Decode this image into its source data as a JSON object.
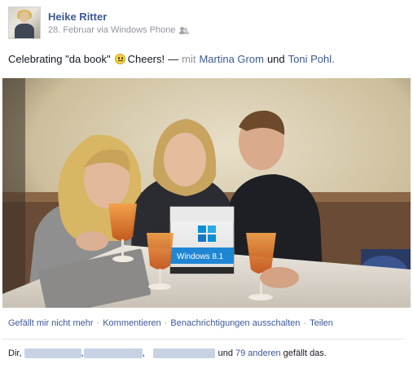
{
  "post": {
    "author": "Heike Ritter",
    "date": "28. Februar",
    "via": "via",
    "source": "Windows Phone",
    "status_text": "Celebrating \"da book\"",
    "status_after": "Cheers!",
    "dash": "—",
    "with_label": "mit",
    "tag_1": "Martina Grom",
    "and_label": "und",
    "tag_2": "Toni Pohl.",
    "book_brand": "Windows 8.1"
  },
  "actions": {
    "unlike": "Gefällt mir nicht mehr",
    "comment": "Kommentieren",
    "notifications": "Benachrichtigungen ausschalten",
    "share": "Teilen",
    "separator": "·"
  },
  "likes": {
    "prefix": "Dir,",
    "comma": ",",
    "and_word": "und",
    "others": "79 anderen",
    "suffix": "gefällt das."
  },
  "icons": {
    "audience": "friends-icon",
    "emoji": "smiley-emoji-icon"
  },
  "colors": {
    "link": "#3b5998",
    "meta": "#90949c",
    "text": "#141823"
  }
}
